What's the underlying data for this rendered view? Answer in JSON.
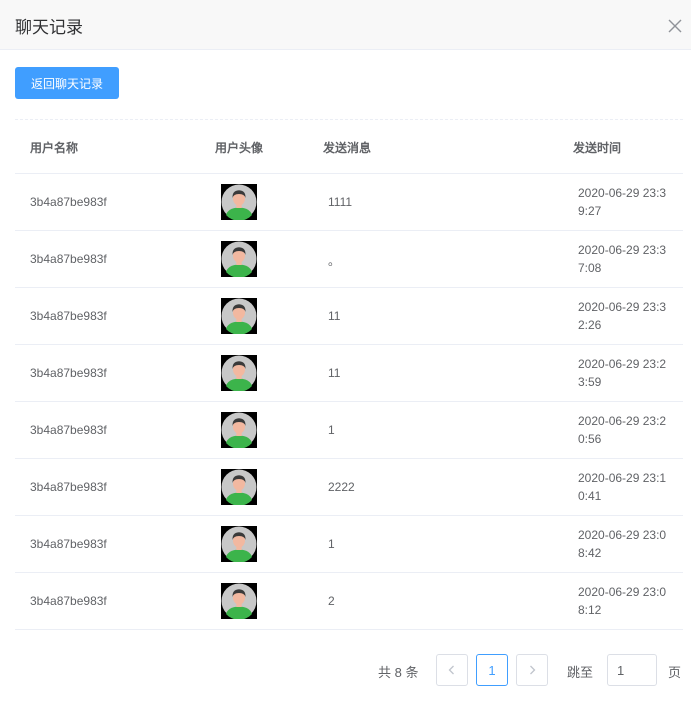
{
  "dialog": {
    "title": "聊天记录",
    "close_icon": "close-icon"
  },
  "toolbar": {
    "back_label": "返回聊天记录"
  },
  "table": {
    "columns": [
      "用户名称",
      "用户头像",
      "发送消息",
      "发送时间"
    ],
    "avatar_icon": "user-avatar-icon",
    "rows": [
      {
        "name": "3b4a87be983f",
        "message": "1111",
        "time": "2020-06-29 23:39:27"
      },
      {
        "name": "3b4a87be983f",
        "message": "。",
        "time": "2020-06-29 23:37:08"
      },
      {
        "name": "3b4a87be983f",
        "message": "11",
        "time": "2020-06-29 23:32:26"
      },
      {
        "name": "3b4a87be983f",
        "message": "11",
        "time": "2020-06-29 23:23:59"
      },
      {
        "name": "3b4a87be983f",
        "message": "1",
        "time": "2020-06-29 23:20:56"
      },
      {
        "name": "3b4a87be983f",
        "message": "2222",
        "time": "2020-06-29 23:10:41"
      },
      {
        "name": "3b4a87be983f",
        "message": "1",
        "time": "2020-06-29 23:08:42"
      },
      {
        "name": "3b4a87be983f",
        "message": "2",
        "time": "2020-06-29 23:08:12"
      }
    ]
  },
  "pagination": {
    "total_text": "共 8 条",
    "current_page": "1",
    "jump_label": "跳至",
    "jump_value": "1",
    "page_suffix": "页"
  },
  "colors": {
    "primary": "#409eff",
    "text": "#606266",
    "border": "#ebeef5",
    "avatar_bg": "#c8c8c8",
    "avatar_shirt": "#3cb44b"
  }
}
